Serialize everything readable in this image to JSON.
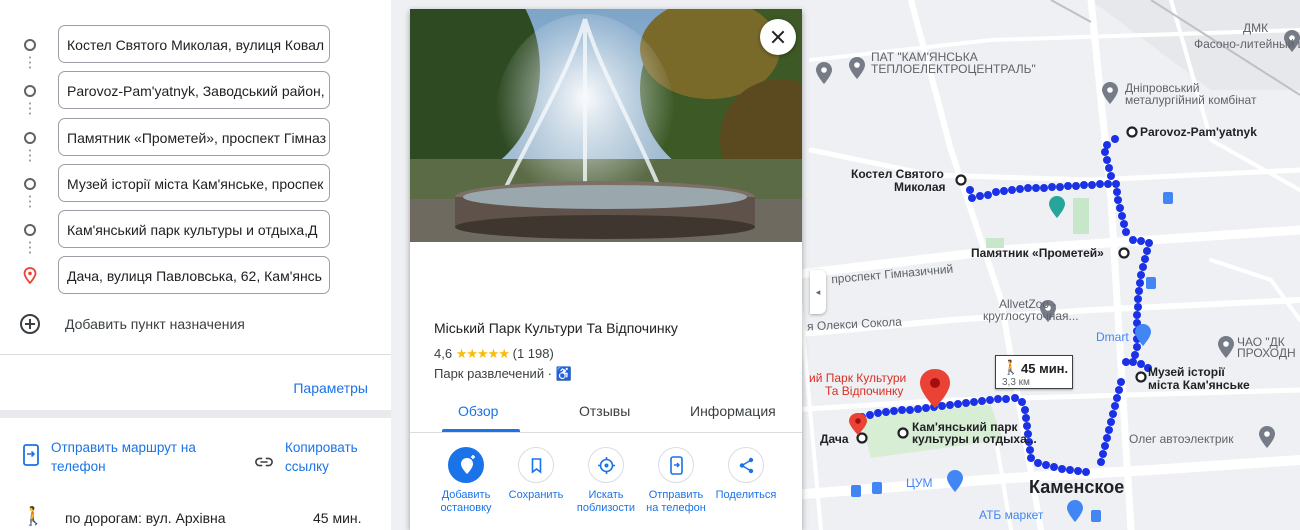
{
  "route": {
    "stops": [
      {
        "value": "Костел Святого Миколая, вулиця Ковал"
      },
      {
        "value": "Parovoz-Pam'yatnyk, Заводський район, "
      },
      {
        "value": "Памятник «Прометей», проспект Гімназ"
      },
      {
        "value": "Музей історії міста Кам'янське, проспек"
      },
      {
        "value": "Кам'янський парк культуры и отдыха,Д"
      },
      {
        "value": "Дача, вулиця Павловська, 62, Кам'янсь"
      }
    ],
    "add_destination": "Добавить пункт назначения",
    "options": "Параметры",
    "send_to_phone": "Отправить маршрут на телефон",
    "send_to_phone_l1": "Отправить маршрут на",
    "send_to_phone_l2": "телефон",
    "copy_link_l1": "Копировать",
    "copy_link_l2": "ссылку",
    "walk_route": "по дорогам: вул. Архівна",
    "walk_duration": "45 мин."
  },
  "place": {
    "title": "Міський Парк Культури Та Відпочинку",
    "rating": "4,6",
    "stars": "★★★★★",
    "reviews_count": "(1 198)",
    "category": "Парк развлечений ·",
    "accessible_icon": "♿",
    "tabs": [
      "Обзор",
      "Отзывы",
      "Информация"
    ],
    "actions": [
      {
        "l1": "Добавить",
        "l2": "остановку",
        "icon": "add-stop-icon"
      },
      {
        "l1": "Сохранить",
        "l2": "",
        "icon": "bookmark-icon"
      },
      {
        "l1": "Искать",
        "l2": "поблизости",
        "icon": "nearby-icon"
      },
      {
        "l1": "Отправить",
        "l2": "на телефон",
        "icon": "send-to-phone-icon"
      },
      {
        "l1": "Поделиться",
        "l2": "",
        "icon": "share-icon"
      }
    ]
  },
  "map": {
    "labels": {
      "dmk": "ДМК",
      "foundry": "Фасоно-литейный цех",
      "tec_l1": "ПАТ \"КАМ'ЯНСЬКА",
      "tec_l2": "ТЕПЛОЕЛЕКТРОЦЕНТРАЛЬ\"",
      "dmk_l1": "Дніпровський",
      "dmk_l2": "металургійний комбінат",
      "parovoz": "Parovoz-Pam'yatnyk",
      "kostel_l1": "Костел Святого",
      "kostel_l2": "Миколая",
      "prometey": "Памятник «Прометей»",
      "gymn_ave": "проспект Гімназичний",
      "allvet_l1": "AllvetZoo -",
      "allvet_l2": "круглосуточная...",
      "sokola": "я Олекси Сокола",
      "dmart": "Dmart",
      "chao_l1": "ЧАО \"ДК",
      "chao_l2": "ПРОХОДН",
      "museum_l1": "Музей історії",
      "museum_l2": "міста Кам'янське",
      "park_red_l1": "ий Парк Культури",
      "park_red_l2": "Та Відпочинку",
      "walk_box_time": "45 мин.",
      "walk_box_dist": "3,3 км",
      "kam_park_l1": "Кам'янський парк",
      "kam_park_l2": "культуры и отдыха...",
      "dacha": "Дача",
      "oleg": "Олег автоэлектрик",
      "tsum": "ЦУМ",
      "kamenskoe": "Каменское",
      "atb": "АТБ маркет"
    }
  },
  "colors": {
    "accent": "#1a73e8",
    "route": "#1a31e6",
    "pin": "#ea4335",
    "poi_gray": "#757b87",
    "poi_teal": "#26a69a"
  }
}
